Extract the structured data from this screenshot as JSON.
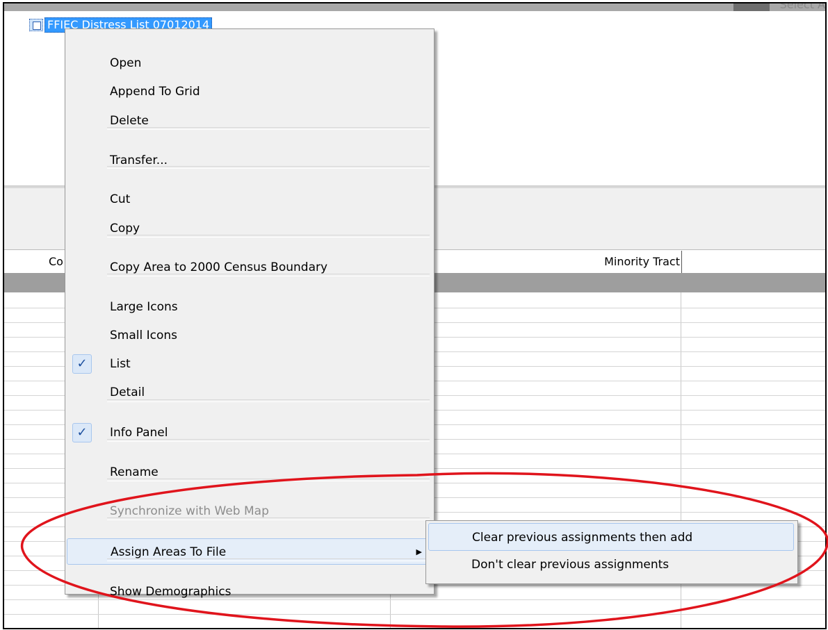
{
  "file_item": {
    "label": "FFIEC Distress List 07012014",
    "icon": "file-list-icon"
  },
  "topbar": {
    "partial_text": "Select A"
  },
  "grid": {
    "headers": {
      "col_a": "Co",
      "minority": "Minority Tract"
    }
  },
  "context_menu": {
    "items": [
      {
        "label": "Open"
      },
      {
        "label": "Append To Grid"
      },
      {
        "label": "Delete"
      },
      {
        "label": "Transfer..."
      },
      {
        "label": "Cut"
      },
      {
        "label": "Copy"
      },
      {
        "label": "Copy Area to 2000 Census Boundary"
      },
      {
        "label": "Large Icons"
      },
      {
        "label": "Small Icons"
      },
      {
        "label": "List",
        "checked": true
      },
      {
        "label": "Detail"
      },
      {
        "label": "Info Panel",
        "checked": true
      },
      {
        "label": "Rename"
      },
      {
        "label": "Synchronize with Web Map",
        "disabled": true
      },
      {
        "label": "Assign Areas To File",
        "submenu": true,
        "highlighted": true
      },
      {
        "label": "Show Demographics"
      }
    ],
    "check_glyph": "✓",
    "submenu_arrow": "▶"
  },
  "submenu": {
    "items": [
      {
        "label": "Clear previous assignments then add",
        "highlighted": true
      },
      {
        "label": "Don't clear previous assignments"
      }
    ]
  },
  "colors": {
    "selection": "#3399ff",
    "menu_bg": "#f0f0f0",
    "highlight": "#e5eef9",
    "annotation": "#e0141c"
  }
}
